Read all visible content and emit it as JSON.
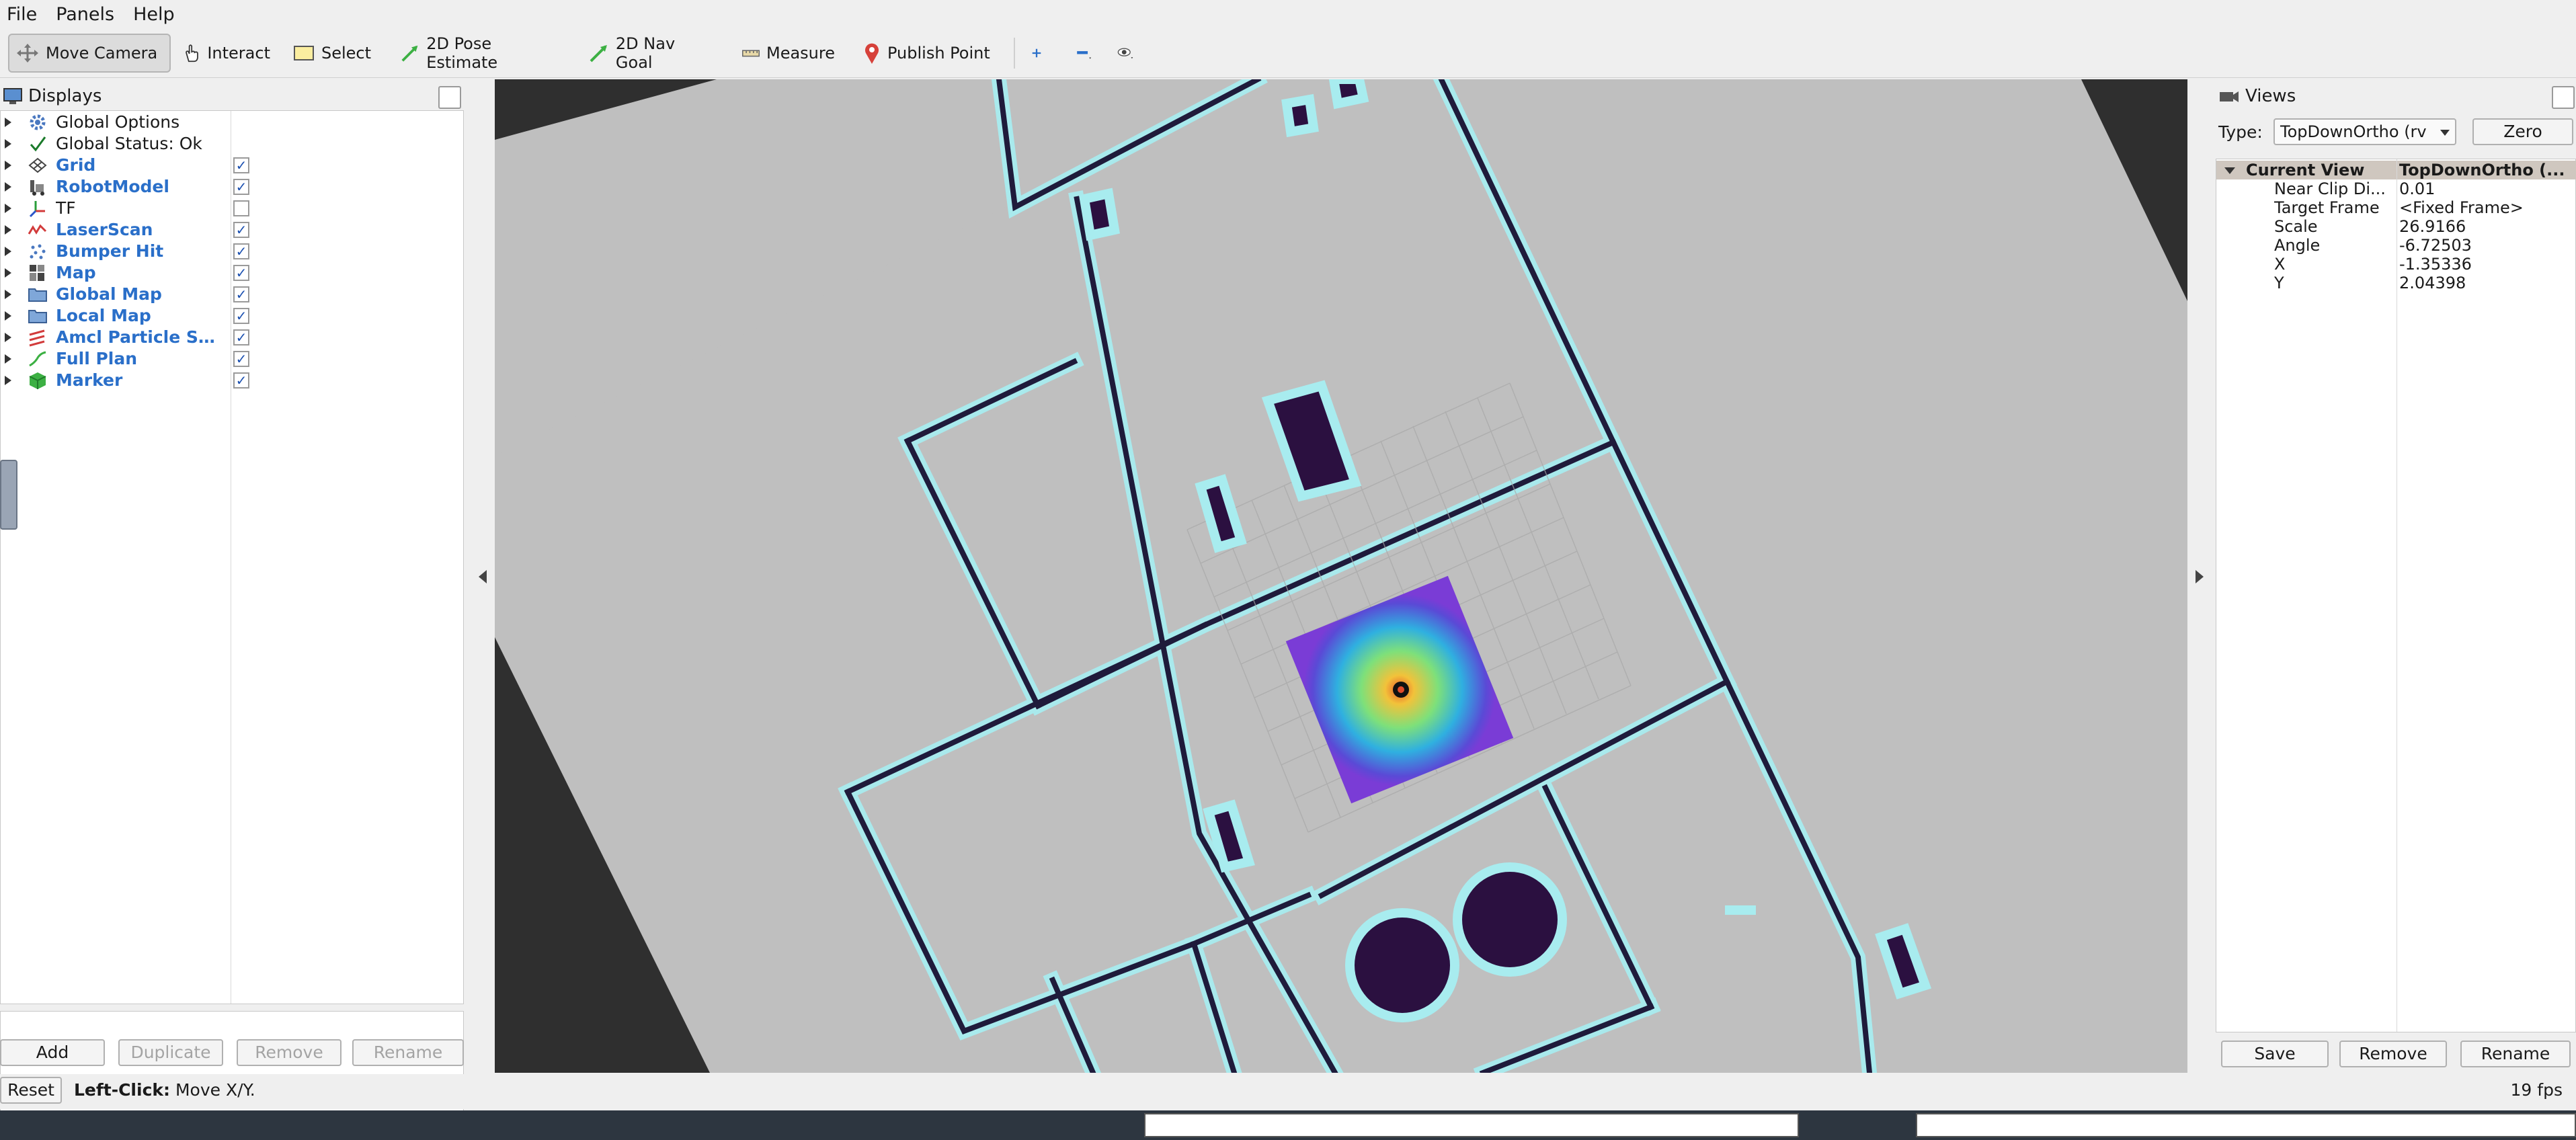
{
  "menu": [
    "File",
    "Panels",
    "Help"
  ],
  "toolbar": {
    "tools": [
      {
        "label": "Move Camera",
        "icon": "move-camera-icon",
        "active": true
      },
      {
        "label": "Interact",
        "icon": "hand-pointer-icon"
      },
      {
        "label": "Select",
        "icon": "select-rect-icon"
      },
      {
        "label": "2D Pose Estimate",
        "icon": "green-arrow-icon"
      },
      {
        "label": "2D Nav Goal",
        "icon": "green-arrow-icon"
      },
      {
        "label": "Measure",
        "icon": "ruler-icon"
      },
      {
        "label": "Publish Point",
        "icon": "map-pin-icon"
      }
    ],
    "extra_icons": [
      "plus-icon",
      "minus-icon",
      "eye-icon"
    ]
  },
  "displays": {
    "title": "Displays",
    "items": [
      {
        "label": "Global Options",
        "icon": "gear-icon",
        "checkbox": null
      },
      {
        "label": "Global Status: Ok",
        "icon": "checkmark-icon",
        "checkbox": null
      },
      {
        "label": "Grid",
        "icon": "grid-icon",
        "checkbox": true
      },
      {
        "label": "RobotModel",
        "icon": "robot-icon",
        "checkbox": true
      },
      {
        "label": "TF",
        "icon": "tf-axes-icon",
        "checkbox": false
      },
      {
        "label": "LaserScan",
        "icon": "laser-icon",
        "checkbox": true
      },
      {
        "label": "Bumper Hit",
        "icon": "dots-icon",
        "checkbox": true
      },
      {
        "label": "Map",
        "icon": "map-icon",
        "checkbox": true
      },
      {
        "label": "Global Map",
        "icon": "folder-icon",
        "checkbox": true
      },
      {
        "label": "Local Map",
        "icon": "folder-icon",
        "checkbox": true
      },
      {
        "label": "Amcl Particle Sw...",
        "icon": "arrows-icon",
        "checkbox": true
      },
      {
        "label": "Full Plan",
        "icon": "path-icon",
        "checkbox": true
      },
      {
        "label": "Marker",
        "icon": "cube-icon",
        "checkbox": true
      }
    ],
    "buttons": {
      "add": "Add",
      "duplicate": "Duplicate",
      "remove": "Remove",
      "rename": "Rename"
    }
  },
  "views": {
    "title": "Views",
    "type_label": "Type:",
    "type_value": "TopDownOrtho (rv",
    "zero_label": "Zero",
    "current_view_label": "Current View",
    "current_view_value": "TopDownOrtho (...",
    "properties": [
      {
        "key": "Near Clip Di...",
        "value": "0.01"
      },
      {
        "key": "Target Frame",
        "value": "<Fixed Frame>"
      },
      {
        "key": "Scale",
        "value": "26.9166"
      },
      {
        "key": "Angle",
        "value": "-6.72503"
      },
      {
        "key": "X",
        "value": "-1.35336"
      },
      {
        "key": "Y",
        "value": "2.04398"
      }
    ],
    "buttons": {
      "save": "Save",
      "remove": "Remove",
      "rename": "Rename"
    }
  },
  "statusbar": {
    "reset": "Reset",
    "hint_bold": "Left-Click:",
    "hint_text": "Move X/Y.",
    "fps": "19 fps"
  },
  "colors": {
    "wall": "#1f1b3b",
    "obstacle": "#2b1040",
    "inflation": "#a8ecef",
    "map_bg": "#bfbfbf",
    "unknown": "#2f2f2f",
    "link_blue": "#2a6fc9"
  }
}
